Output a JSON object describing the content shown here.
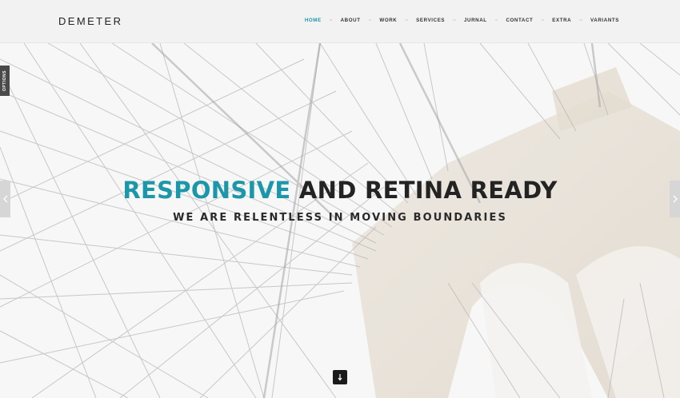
{
  "brand": {
    "logo": "DEMETER"
  },
  "nav": {
    "items": [
      {
        "label": "HOME",
        "active": true
      },
      {
        "label": "ABOUT",
        "active": false
      },
      {
        "label": "WORK",
        "active": false
      },
      {
        "label": "SERVICES",
        "active": false
      },
      {
        "label": "JURNAL",
        "active": false
      },
      {
        "label": "CONTACT",
        "active": false
      },
      {
        "label": "EXTRA",
        "active": false
      },
      {
        "label": "VARIANTS",
        "active": false
      }
    ],
    "separator": "="
  },
  "hero": {
    "headline_accent": "RESPONSIVE",
    "headline_rest": " AND RETINA READY",
    "subheadline": "WE ARE RELENTLESS IN MOVING BOUNDARIES"
  },
  "controls": {
    "options_label": "OPTIONS",
    "prev_icon": "chevron-left-icon",
    "next_icon": "chevron-right-icon",
    "scroll_icon": "arrow-down-icon"
  },
  "colors": {
    "accent": "#1c97a9",
    "text_dark": "#232323",
    "header_bg": "#f2f2f2",
    "options_bg": "#4a4a4a",
    "scroll_btn_bg": "#1b1b1b"
  }
}
